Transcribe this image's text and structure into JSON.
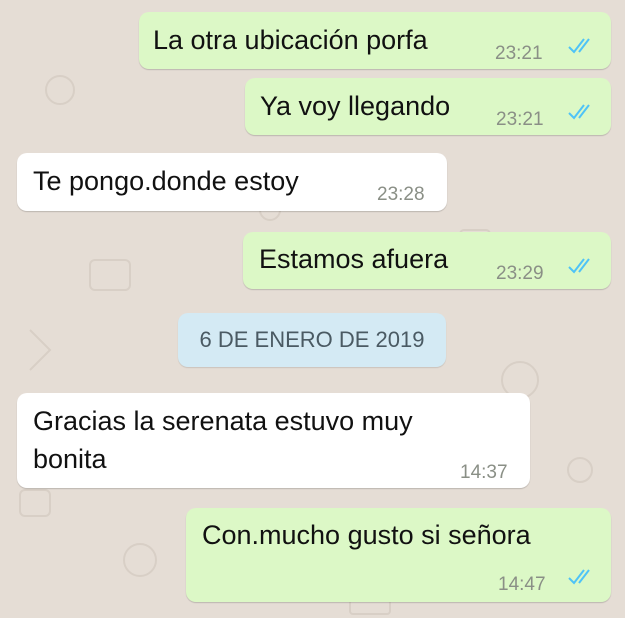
{
  "messages": [
    {
      "direction": "outgoing",
      "text": "La otra ubicación porfa",
      "time": "23:21",
      "read": true
    },
    {
      "direction": "outgoing",
      "text": "Ya voy llegando",
      "time": "23:21",
      "read": true
    },
    {
      "direction": "incoming",
      "text": "Te pongo.donde estoy",
      "time": "23:28"
    },
    {
      "direction": "outgoing",
      "text": "Estamos afuera",
      "time": "23:29",
      "read": true
    },
    {
      "direction": "incoming",
      "text_line1": "Gracias la serenata estuvo muy",
      "text_line2": "bonita",
      "time": "14:37"
    },
    {
      "direction": "outgoing",
      "text": "Con.mucho gusto si señora",
      "time": "14:47",
      "read": true
    }
  ],
  "date_divider": "6 DE ENERO DE 2019",
  "colors": {
    "outgoing_bubble": "#dcf8c6",
    "incoming_bubble": "#ffffff",
    "background": "#e5ddd5",
    "read_ticks": "#4fc3f7",
    "date_chip": "#d4eaf4"
  },
  "icons": [
    "double-check-icon"
  ]
}
